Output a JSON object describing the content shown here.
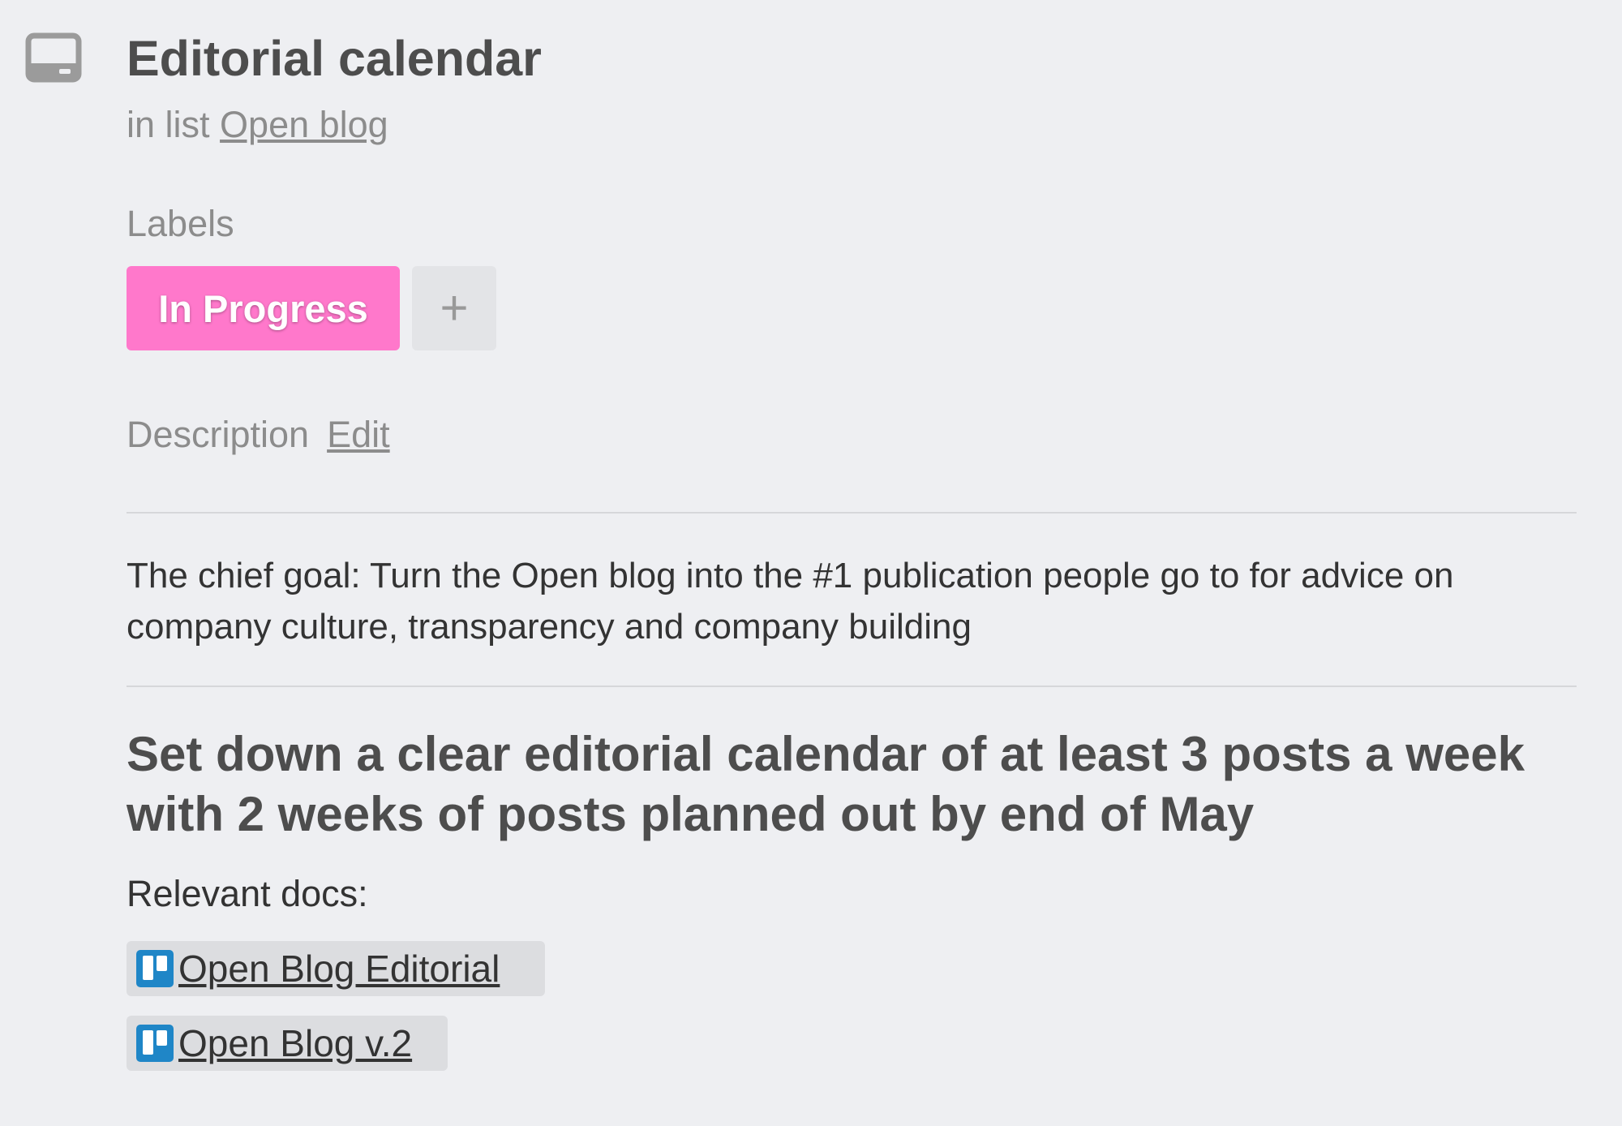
{
  "card": {
    "title": "Editorial calendar",
    "in_list_prefix": "in list",
    "list_name": "Open blog"
  },
  "labels": {
    "heading": "Labels",
    "items": [
      {
        "text": "In Progress",
        "color": "#ff78cb"
      }
    ],
    "add_symbol": "+"
  },
  "description": {
    "heading": "Description",
    "edit_link": "Edit",
    "text": "The chief goal: Turn the Open blog into the #1 publication people go to for advice on company culture, transparency and company building",
    "goal_heading": "Set down a clear editorial calendar of at least 3 posts a week with 2 weeks of posts planned out by end of May",
    "relevant_docs_label": "Relevant docs:",
    "docs": [
      {
        "icon": "trello-board-icon",
        "title": "Open Blog Editorial"
      },
      {
        "icon": "trello-board-icon",
        "title": "Open Blog v.2"
      }
    ]
  },
  "colors": {
    "background": "#eeeff2",
    "label_pink": "#ff78cb",
    "trello_blue": "#1f86c7"
  }
}
